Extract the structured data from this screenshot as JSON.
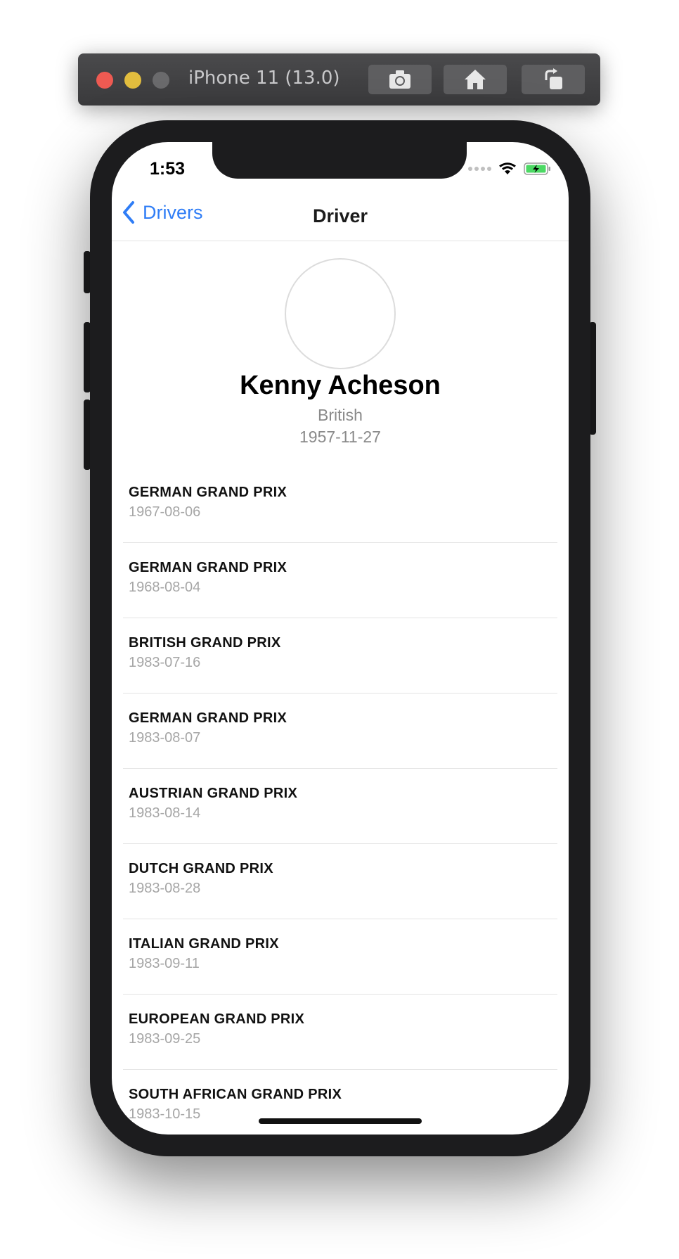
{
  "simulator": {
    "title": "iPhone 11 (13.0)",
    "buttons": [
      "camera-icon",
      "home-icon",
      "rotate-icon"
    ]
  },
  "status_bar": {
    "time": "1:53"
  },
  "nav": {
    "back_label": "Drivers",
    "title": "Driver"
  },
  "driver": {
    "name": "Kenny Acheson",
    "nationality": "British",
    "dob": "1957-11-27"
  },
  "races": [
    {
      "name": "GERMAN GRAND PRIX",
      "date": "1967-08-06"
    },
    {
      "name": "GERMAN GRAND PRIX",
      "date": "1968-08-04"
    },
    {
      "name": "BRITISH GRAND PRIX",
      "date": "1983-07-16"
    },
    {
      "name": "GERMAN GRAND PRIX",
      "date": "1983-08-07"
    },
    {
      "name": "AUSTRIAN GRAND PRIX",
      "date": "1983-08-14"
    },
    {
      "name": "DUTCH GRAND PRIX",
      "date": "1983-08-28"
    },
    {
      "name": "ITALIAN GRAND PRIX",
      "date": "1983-09-11"
    },
    {
      "name": "EUROPEAN GRAND PRIX",
      "date": "1983-09-25"
    },
    {
      "name": "SOUTH AFRICAN GRAND PRIX",
      "date": "1983-10-15"
    }
  ],
  "colors": {
    "accent": "#2f7df6",
    "battery": "#4cd964"
  }
}
